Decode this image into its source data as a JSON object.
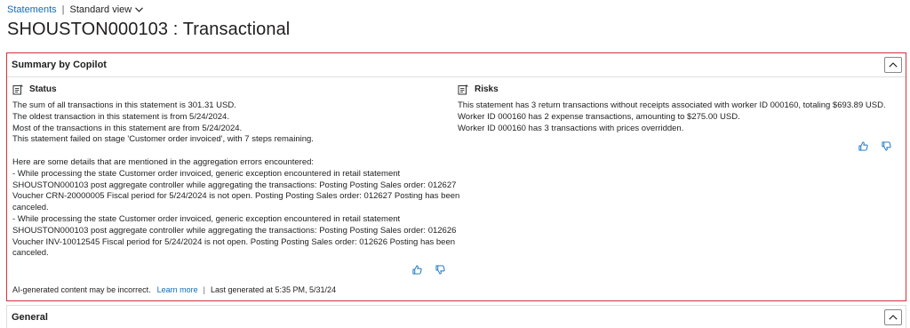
{
  "breadcrumb": {
    "link": "Statements",
    "view": "Standard view"
  },
  "page": {
    "title": "SHOUSTON000103 : Transactional"
  },
  "summary_card": {
    "title": "Summary by Copilot",
    "status": {
      "title": "Status",
      "lines": [
        "The sum of all transactions in this statement is 301.31 USD.",
        "The oldest transaction in this statement is from 5/24/2024.",
        "Most of the transactions in this statement are from 5/24/2024.",
        "This statement failed on stage 'Customer order invoiced', with 7 steps remaining.",
        "",
        "Here are some details that are mentioned in the aggregation errors encountered:",
        "- While processing the state Customer order invoiced, generic exception encountered in retail statement",
        "SHOUSTON000103 post aggregate controller while aggregating the transactions: Posting Posting Sales order: 012627",
        "Voucher CRN-20000005 Fiscal period for 5/24/2024 is not open. Posting Posting Sales order: 012627 Posting has been",
        "canceled.",
        "- While processing the state Customer order invoiced, generic exception encountered in retail statement",
        "SHOUSTON000103 post aggregate controller while aggregating the transactions: Posting Posting Sales order: 012626",
        "Voucher INV-10012545 Fiscal period for 5/24/2024 is not open. Posting Posting Sales order: 012626 Posting has been",
        "canceled."
      ]
    },
    "risks": {
      "title": "Risks",
      "lines": [
        "This statement has 3 return transactions without receipts associated with worker ID 000160, totaling $693.89 USD.",
        "Worker ID 000160 has 2 expense transactions, amounting to $275.00 USD.",
        "Worker ID 000160 has 3 transactions with prices overridden."
      ]
    },
    "footer": {
      "disclaimer": "AI-generated content may be incorrect.",
      "learn_more": "Learn more",
      "separator": "|",
      "last_generated": "Last generated at 5:35 PM, 5/31/24"
    }
  },
  "general_card": {
    "title": "General"
  },
  "icons": {
    "chevron_down": "chevron-down-icon",
    "chevron_up": "chevron-up-icon",
    "document": "document-edit-icon",
    "thumbs_up": "thumbs-up-icon",
    "thumbs_down": "thumbs-down-icon"
  },
  "colors": {
    "accent": "#0f6cbd",
    "highlight_border": "#d13438"
  }
}
